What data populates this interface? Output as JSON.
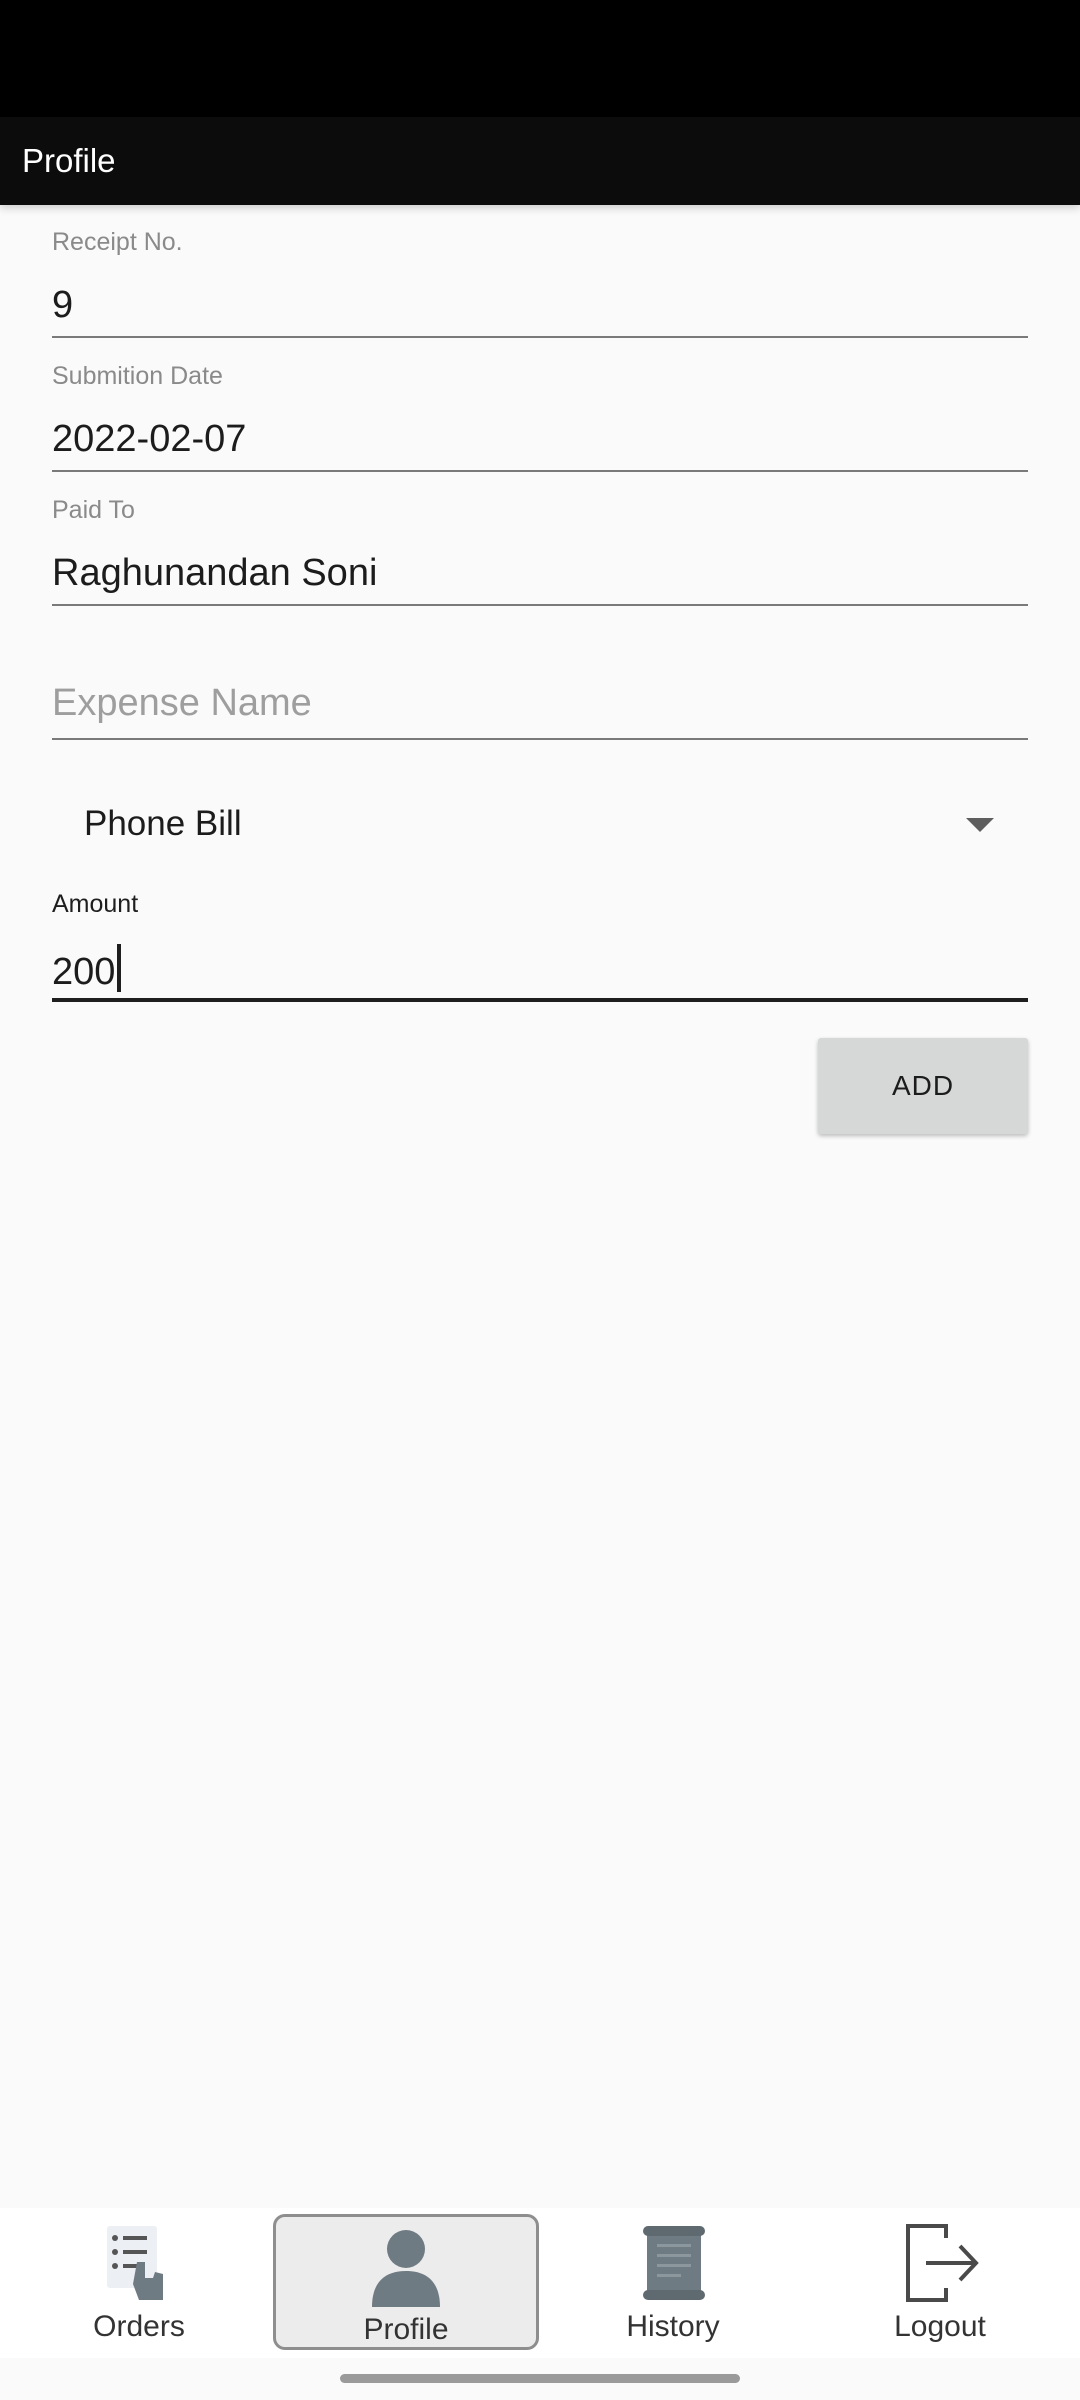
{
  "app_bar": {
    "title": "Profile"
  },
  "form": {
    "receipt": {
      "label": "Receipt No.",
      "value": "9"
    },
    "submission_date": {
      "label": "Submition Date",
      "value": "2022-02-07"
    },
    "paid_to": {
      "label": "Paid To",
      "value": "Raghunandan Soni"
    },
    "expense_name": {
      "placeholder": "Expense Name",
      "value": ""
    },
    "expense_type": {
      "selected": "Phone Bill"
    },
    "amount": {
      "label": "Amount",
      "value": "200"
    },
    "add_label": "ADD"
  },
  "bottom_nav": {
    "active": "Profile",
    "items": [
      {
        "label": "Orders",
        "icon": "orders-list-icon"
      },
      {
        "label": "Profile",
        "icon": "user-icon"
      },
      {
        "label": "History",
        "icon": "scroll-icon"
      },
      {
        "label": "Logout",
        "icon": "logout-icon"
      }
    ]
  },
  "colors": {
    "app_bar": "#0c0c0c",
    "background": "#fafafa",
    "button": "#d6d7d7",
    "icon_gray": "#6f7b82"
  }
}
